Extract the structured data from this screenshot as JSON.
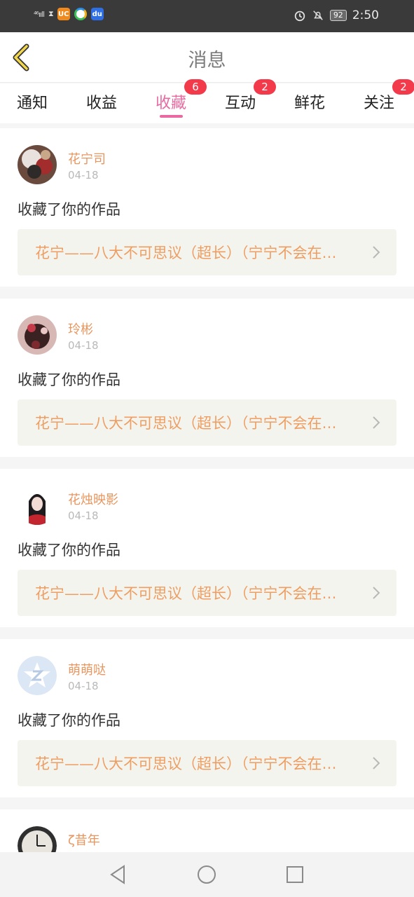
{
  "status_bar": {
    "signal_text": "⁴⁶ııll",
    "hourglass": "⧗",
    "app_icons": [
      "uc-browser-icon",
      "ring-app-icon",
      "baidu-icon"
    ],
    "uc_label": "UC",
    "baidu_label": "du",
    "battery": "92",
    "time": "2:50"
  },
  "nav": {
    "title": "消息"
  },
  "tabs": [
    {
      "label": "通知",
      "badge": ""
    },
    {
      "label": "收益",
      "badge": ""
    },
    {
      "label": "收藏",
      "badge": "6",
      "active": true
    },
    {
      "label": "互动",
      "badge": "2"
    },
    {
      "label": "鲜花",
      "badge": ""
    },
    {
      "label": "关注",
      "badge": "2"
    }
  ],
  "colors": {
    "accent": "#e86aa1",
    "username": "#e8965f",
    "work_title": "#ee9e62",
    "badge": "#f23a4a"
  },
  "feed": [
    {
      "user": "花宁司",
      "date": "04-18",
      "action": "收藏了你的作品",
      "work": "花宁——八大不可思议（超长）（宁宁不会在…"
    },
    {
      "user": "玲彬",
      "date": "04-18",
      "action": "收藏了你的作品",
      "work": "花宁——八大不可思议（超长）（宁宁不会在…"
    },
    {
      "user": "花烛映影",
      "date": "04-18",
      "action": "收藏了你的作品",
      "work": "花宁——八大不可思议（超长）（宁宁不会在…"
    },
    {
      "user": "萌萌哒",
      "date": "04-18",
      "action": "收藏了你的作品",
      "work": "花宁——八大不可思议（超长）（宁宁不会在…"
    },
    {
      "user": "ζ昔年",
      "date": "",
      "action": "",
      "work": ""
    }
  ]
}
